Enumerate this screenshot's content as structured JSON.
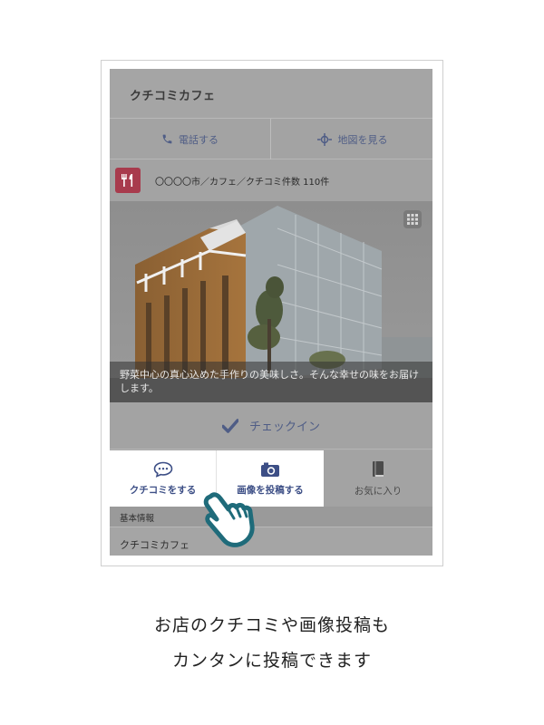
{
  "app": {
    "title": "クチコミカフェ"
  },
  "actions": {
    "call_label": "電話する",
    "map_label": "地図を見る"
  },
  "info": {
    "category_icon": "restaurant-icon",
    "text": "〇〇〇〇市／カフェ／クチコミ件数 110件"
  },
  "photo": {
    "caption": "野菜中心の真心込めた手作りの美味しさ。そんな幸せの味をお届けします。"
  },
  "checkin": {
    "label": "チェックイン"
  },
  "tabs": [
    {
      "label": "クチコミをする",
      "icon": "chat-bubble-icon"
    },
    {
      "label": "画像を投稿する",
      "icon": "camera-icon"
    },
    {
      "label": "お気に入り",
      "icon": "bookmark-icon"
    }
  ],
  "basic_info": {
    "header": "基本情報",
    "name": "クチコミカフェ"
  },
  "tagline": {
    "line1": "お店のクチコミや画像投稿も",
    "line2": "カンタンに投稿できます"
  },
  "colors": {
    "accent": "#4f5d86",
    "category": "#a83b4d",
    "hand": "#1f6b7a"
  }
}
